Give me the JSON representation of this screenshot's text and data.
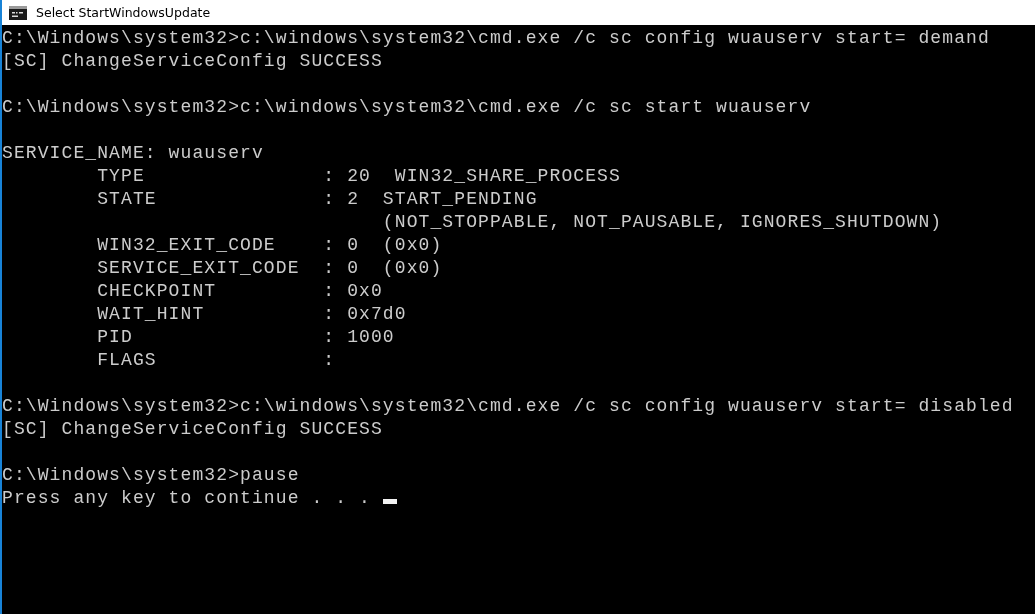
{
  "window": {
    "title": "Select StartWindowsUpdate"
  },
  "console": {
    "cursor_visible": true,
    "blocks": [
      {
        "lines": [
          "C:\\Windows\\system32>c:\\windows\\system32\\cmd.exe /c sc config wuauserv start= demand",
          "[SC] ChangeServiceConfig SUCCESS"
        ]
      },
      {
        "lines": [
          "C:\\Windows\\system32>c:\\windows\\system32\\cmd.exe /c sc start wuauserv"
        ]
      },
      {
        "lines": [
          "SERVICE_NAME: wuauserv",
          "        TYPE               : 20  WIN32_SHARE_PROCESS",
          "        STATE              : 2  START_PENDING",
          "                                (NOT_STOPPABLE, NOT_PAUSABLE, IGNORES_SHUTDOWN)",
          "        WIN32_EXIT_CODE    : 0  (0x0)",
          "        SERVICE_EXIT_CODE  : 0  (0x0)",
          "        CHECKPOINT         : 0x0",
          "        WAIT_HINT          : 0x7d0",
          "        PID                : 1000",
          "        FLAGS              :"
        ]
      },
      {
        "lines": [
          "C:\\Windows\\system32>c:\\windows\\system32\\cmd.exe /c sc config wuauserv start= disabled",
          "[SC] ChangeServiceConfig SUCCESS"
        ]
      },
      {
        "lines": [
          "C:\\Windows\\system32>pause",
          "Press any key to continue . . . "
        ]
      }
    ]
  }
}
